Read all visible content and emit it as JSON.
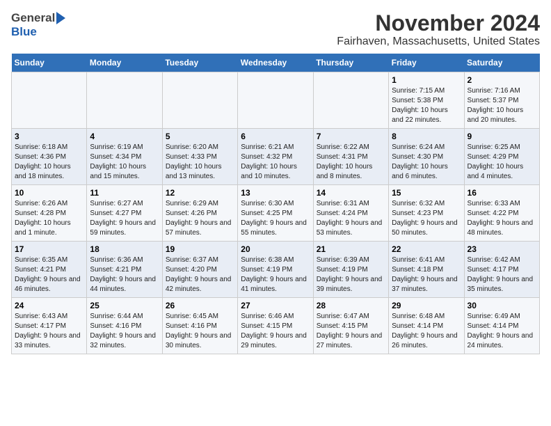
{
  "logo": {
    "general": "General",
    "blue": "Blue"
  },
  "title": "November 2024",
  "subtitle": "Fairhaven, Massachusetts, United States",
  "headers": [
    "Sunday",
    "Monday",
    "Tuesday",
    "Wednesday",
    "Thursday",
    "Friday",
    "Saturday"
  ],
  "weeks": [
    [
      {
        "day": "",
        "info": ""
      },
      {
        "day": "",
        "info": ""
      },
      {
        "day": "",
        "info": ""
      },
      {
        "day": "",
        "info": ""
      },
      {
        "day": "",
        "info": ""
      },
      {
        "day": "1",
        "info": "Sunrise: 7:15 AM\nSunset: 5:38 PM\nDaylight: 10 hours and 22 minutes."
      },
      {
        "day": "2",
        "info": "Sunrise: 7:16 AM\nSunset: 5:37 PM\nDaylight: 10 hours and 20 minutes."
      }
    ],
    [
      {
        "day": "3",
        "info": "Sunrise: 6:18 AM\nSunset: 4:36 PM\nDaylight: 10 hours and 18 minutes."
      },
      {
        "day": "4",
        "info": "Sunrise: 6:19 AM\nSunset: 4:34 PM\nDaylight: 10 hours and 15 minutes."
      },
      {
        "day": "5",
        "info": "Sunrise: 6:20 AM\nSunset: 4:33 PM\nDaylight: 10 hours and 13 minutes."
      },
      {
        "day": "6",
        "info": "Sunrise: 6:21 AM\nSunset: 4:32 PM\nDaylight: 10 hours and 10 minutes."
      },
      {
        "day": "7",
        "info": "Sunrise: 6:22 AM\nSunset: 4:31 PM\nDaylight: 10 hours and 8 minutes."
      },
      {
        "day": "8",
        "info": "Sunrise: 6:24 AM\nSunset: 4:30 PM\nDaylight: 10 hours and 6 minutes."
      },
      {
        "day": "9",
        "info": "Sunrise: 6:25 AM\nSunset: 4:29 PM\nDaylight: 10 hours and 4 minutes."
      }
    ],
    [
      {
        "day": "10",
        "info": "Sunrise: 6:26 AM\nSunset: 4:28 PM\nDaylight: 10 hours and 1 minute."
      },
      {
        "day": "11",
        "info": "Sunrise: 6:27 AM\nSunset: 4:27 PM\nDaylight: 9 hours and 59 minutes."
      },
      {
        "day": "12",
        "info": "Sunrise: 6:29 AM\nSunset: 4:26 PM\nDaylight: 9 hours and 57 minutes."
      },
      {
        "day": "13",
        "info": "Sunrise: 6:30 AM\nSunset: 4:25 PM\nDaylight: 9 hours and 55 minutes."
      },
      {
        "day": "14",
        "info": "Sunrise: 6:31 AM\nSunset: 4:24 PM\nDaylight: 9 hours and 53 minutes."
      },
      {
        "day": "15",
        "info": "Sunrise: 6:32 AM\nSunset: 4:23 PM\nDaylight: 9 hours and 50 minutes."
      },
      {
        "day": "16",
        "info": "Sunrise: 6:33 AM\nSunset: 4:22 PM\nDaylight: 9 hours and 48 minutes."
      }
    ],
    [
      {
        "day": "17",
        "info": "Sunrise: 6:35 AM\nSunset: 4:21 PM\nDaylight: 9 hours and 46 minutes."
      },
      {
        "day": "18",
        "info": "Sunrise: 6:36 AM\nSunset: 4:21 PM\nDaylight: 9 hours and 44 minutes."
      },
      {
        "day": "19",
        "info": "Sunrise: 6:37 AM\nSunset: 4:20 PM\nDaylight: 9 hours and 42 minutes."
      },
      {
        "day": "20",
        "info": "Sunrise: 6:38 AM\nSunset: 4:19 PM\nDaylight: 9 hours and 41 minutes."
      },
      {
        "day": "21",
        "info": "Sunrise: 6:39 AM\nSunset: 4:19 PM\nDaylight: 9 hours and 39 minutes."
      },
      {
        "day": "22",
        "info": "Sunrise: 6:41 AM\nSunset: 4:18 PM\nDaylight: 9 hours and 37 minutes."
      },
      {
        "day": "23",
        "info": "Sunrise: 6:42 AM\nSunset: 4:17 PM\nDaylight: 9 hours and 35 minutes."
      }
    ],
    [
      {
        "day": "24",
        "info": "Sunrise: 6:43 AM\nSunset: 4:17 PM\nDaylight: 9 hours and 33 minutes."
      },
      {
        "day": "25",
        "info": "Sunrise: 6:44 AM\nSunset: 4:16 PM\nDaylight: 9 hours and 32 minutes."
      },
      {
        "day": "26",
        "info": "Sunrise: 6:45 AM\nSunset: 4:16 PM\nDaylight: 9 hours and 30 minutes."
      },
      {
        "day": "27",
        "info": "Sunrise: 6:46 AM\nSunset: 4:15 PM\nDaylight: 9 hours and 29 minutes."
      },
      {
        "day": "28",
        "info": "Sunrise: 6:47 AM\nSunset: 4:15 PM\nDaylight: 9 hours and 27 minutes."
      },
      {
        "day": "29",
        "info": "Sunrise: 6:48 AM\nSunset: 4:14 PM\nDaylight: 9 hours and 26 minutes."
      },
      {
        "day": "30",
        "info": "Sunrise: 6:49 AM\nSunset: 4:14 PM\nDaylight: 9 hours and 24 minutes."
      }
    ]
  ]
}
